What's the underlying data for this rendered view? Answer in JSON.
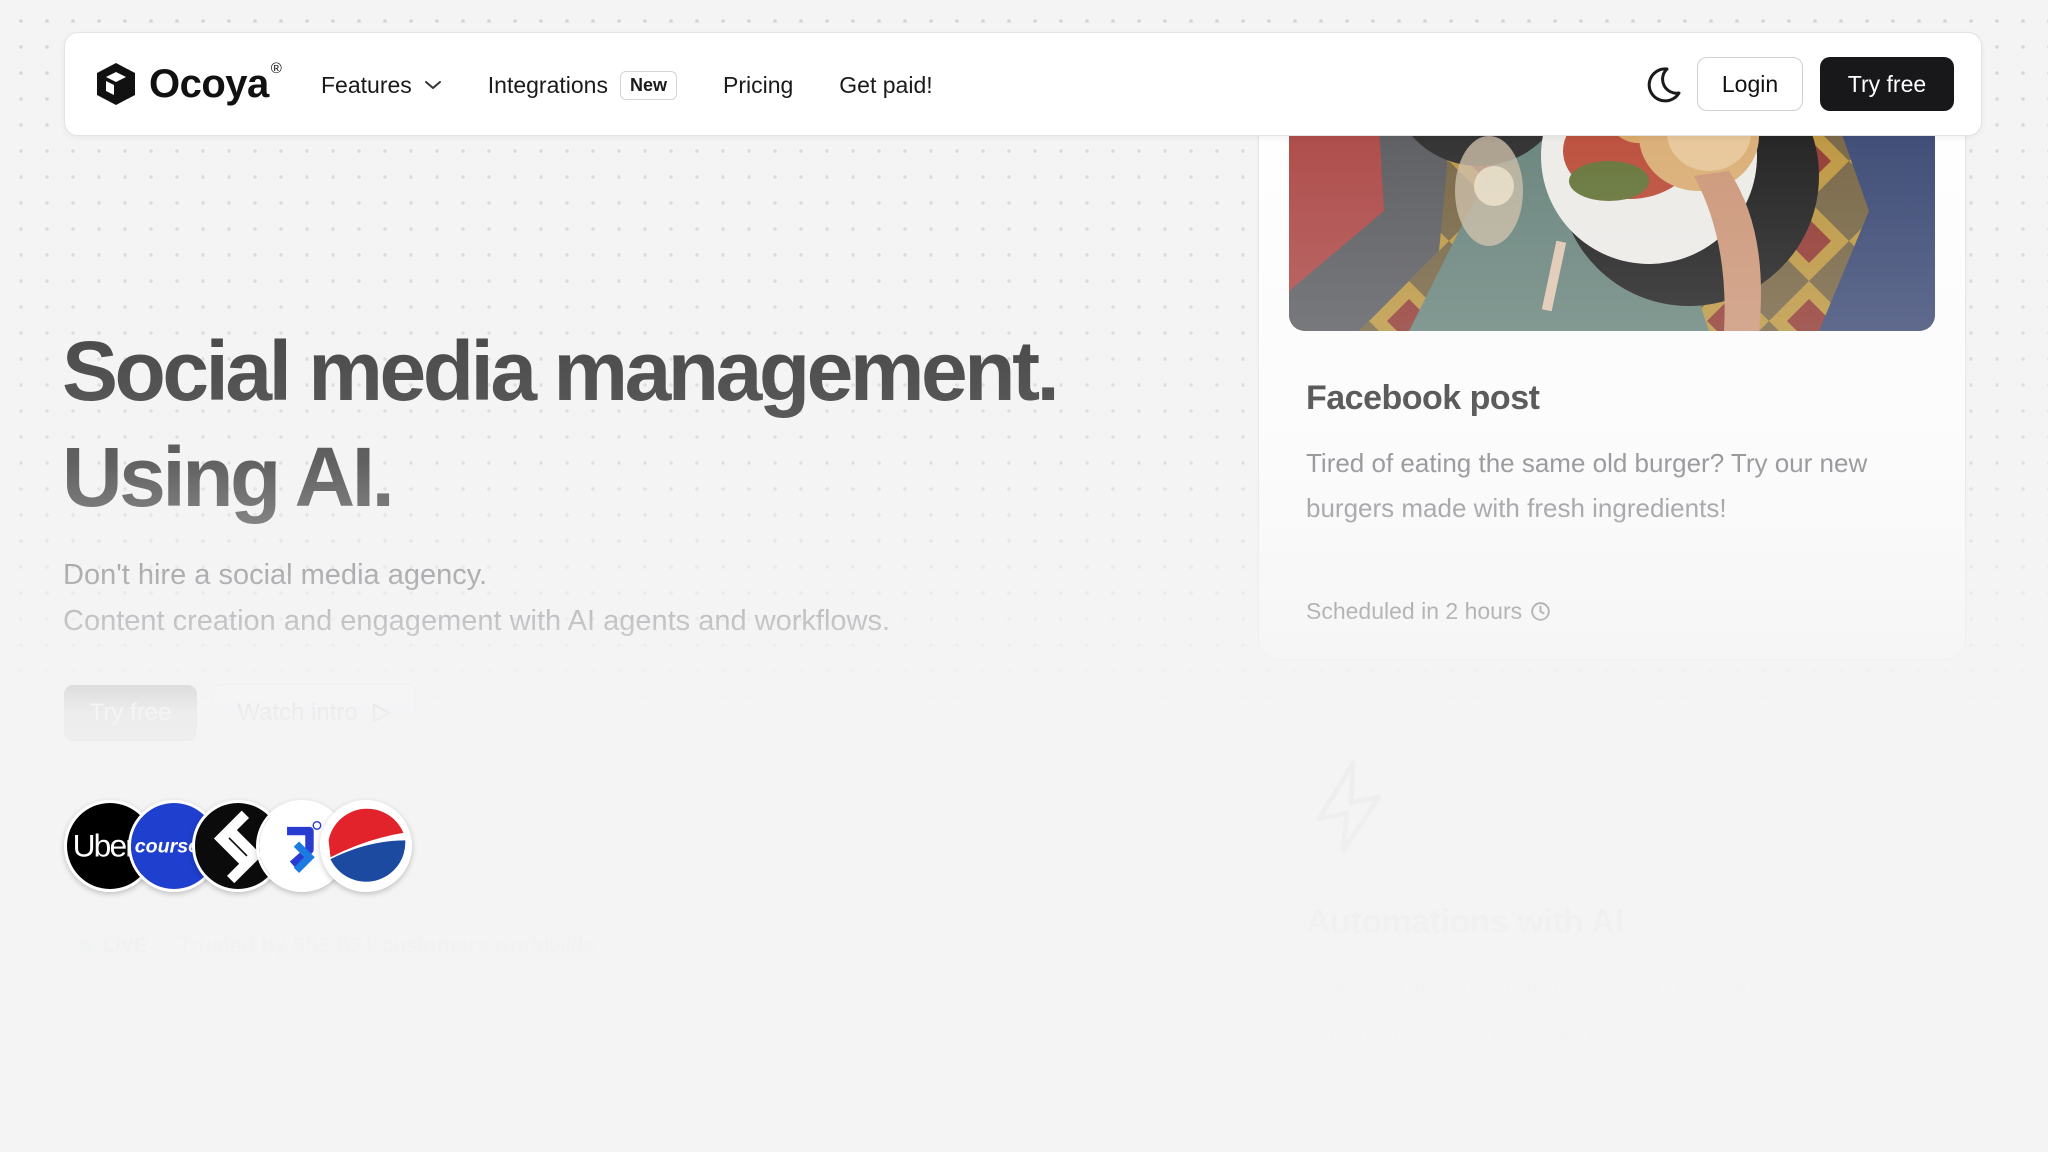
{
  "nav": {
    "brand": "Ocoya",
    "brand_reg": "®",
    "links": [
      {
        "label": "Features",
        "icon": "chevron-down-icon"
      },
      {
        "label": "Integrations",
        "badge": "New"
      },
      {
        "label": "Pricing"
      },
      {
        "label": "Get paid!"
      }
    ],
    "theme_toggle_icon": "moon-icon",
    "login_label": "Login",
    "try_free_label": "Try free"
  },
  "hero": {
    "title_line1": "Social media management.",
    "title_line2": "Using AI.",
    "subtitle_line1": "Don't hire a social media agency.",
    "subtitle_line2": "Content creation and engagement with AI agents and workflows.",
    "primary_cta": "Try free",
    "secondary_cta": "Watch intro",
    "customer_logos": [
      "Uber",
      "course",
      "stylized S logo",
      "blue arrow logo",
      "Pepsi"
    ],
    "live_label": "LIVE",
    "trusted_text": "Trusted by 553,821 customers worldwide."
  },
  "cards": [
    {
      "title": "Facebook post",
      "body": "Tired of eating the same old burger? Try our new burgers made with fresh ingredients!",
      "status": "Scheduled in 2 hours",
      "status_icon": "clock-icon"
    },
    {
      "icon": "lightning-bolt-icon",
      "title": "Automations with AI",
      "body": "Create and schedule posts with the help of automations and AI agents."
    }
  ],
  "colors": {
    "background": "#f4f4f5",
    "primary_button": "#18181b",
    "live_dot": "#22c55e"
  }
}
